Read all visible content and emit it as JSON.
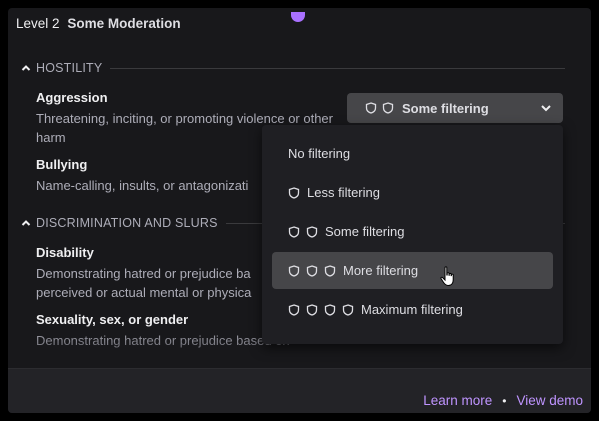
{
  "header": {
    "level": "Level 2",
    "name": "Some Moderation"
  },
  "sections": [
    {
      "label": "HOSTILITY",
      "items": [
        {
          "name": "Aggression",
          "description": "Threatening, inciting, or promoting violence or other harm"
        },
        {
          "name": "Bullying",
          "description": "Name-calling, insults, or antagonizati"
        }
      ]
    },
    {
      "label": "DISCRIMINATION AND SLURS",
      "items": [
        {
          "name": "Disability",
          "description": "Demonstrating hatred or prejudice ba perceived or actual mental or physica"
        },
        {
          "name": "Sexuality, sex, or gender",
          "description": "Demonstrating hatred or prejudice based on"
        }
      ]
    }
  ],
  "select": {
    "value": "Some filtering",
    "icon": "shield-icon"
  },
  "dropdown": {
    "options": [
      {
        "label": "No filtering",
        "shields": 0
      },
      {
        "label": "Less filtering",
        "shields": 1
      },
      {
        "label": "Some filtering",
        "shields": 2
      },
      {
        "label": "More filtering",
        "shields": 3,
        "hovered": true
      },
      {
        "label": "Maximum filtering",
        "shields": 4
      }
    ]
  },
  "footer": {
    "learn_more": "Learn more",
    "separator": "•",
    "view_demo": "View demo"
  },
  "colors": {
    "accent": "#a970ff",
    "link": "#bf94ff",
    "background": "#18181b",
    "dropdown": "#1f1f23",
    "hover": "#464649"
  }
}
